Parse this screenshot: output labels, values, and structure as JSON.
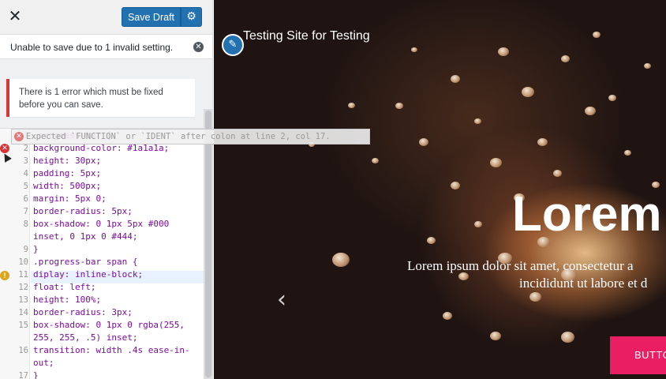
{
  "customizer": {
    "close_icon": "close-icon",
    "save_draft_label": "Save Draft",
    "gear_icon": "gear-icon",
    "notice_text": "Unable to save due to 1 invalid setting.",
    "error_text": "There is 1 error which must be fixed before you can save."
  },
  "editor": {
    "lint_message": "Expected `FUNCTION` or `IDENT` after colon at line 2, col 17.",
    "lines": [
      {
        "n": "1",
        "text": ".progress-bar {"
      },
      {
        "n": "2",
        "text": "background-color: #1a1a1a;"
      },
      {
        "n": "3",
        "text": "height: 30px;"
      },
      {
        "n": "4",
        "text": "padding: 5px;"
      },
      {
        "n": "5",
        "text": "width: 500px;"
      },
      {
        "n": "6",
        "text": "margin: 5px 0;"
      },
      {
        "n": "7",
        "text": "border-radius: 5px;"
      },
      {
        "n": "8",
        "text": "box-shadow: 0 1px 5px #000"
      },
      {
        "n": "",
        "text": "inset, 0 1px 0 #444;"
      },
      {
        "n": "9",
        "text": "}"
      },
      {
        "n": "10",
        "text": ".progress-bar span {"
      },
      {
        "n": "11",
        "text": "diplay: inline-block;"
      },
      {
        "n": "12",
        "text": "float: left;"
      },
      {
        "n": "13",
        "text": "height: 100%;"
      },
      {
        "n": "14",
        "text": "border-radius: 3px;"
      },
      {
        "n": "15",
        "text": "box-shadow: 0 1px 0 rgba(255,"
      },
      {
        "n": "",
        "text": "255, 255, .5) inset;"
      },
      {
        "n": "16",
        "text": "transition: width .4s ease-in-"
      },
      {
        "n": "",
        "text": "out;"
      },
      {
        "n": "17",
        "text": "}"
      }
    ]
  },
  "preview": {
    "site_title": "Testing Site for Testing",
    "hero_title": "Lorem I",
    "hero_text_1": "Lorem ipsum dolor sit amet, consectetur a",
    "hero_text_2": "incididunt ut labore et d",
    "prev_arrow": "‹",
    "button_label": "BUTTO"
  },
  "colors": {
    "primary": "#2271b1",
    "error": "#d63638",
    "warning": "#dba617",
    "hero_button": "#e91e63"
  }
}
